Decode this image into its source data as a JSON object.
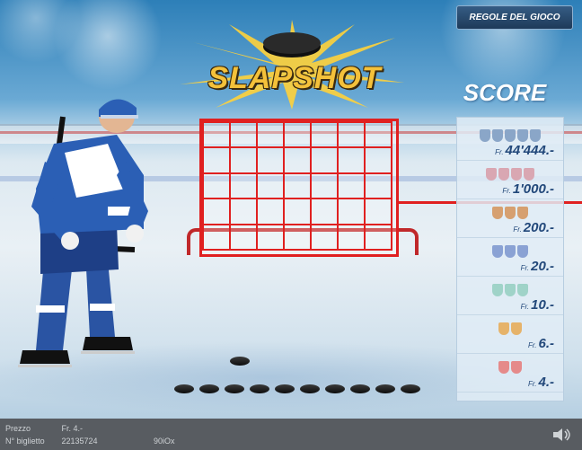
{
  "header": {
    "rules_label": "REGOLE DEL GIOCO"
  },
  "logo": {
    "text": "SLAPSHOT"
  },
  "score": {
    "title": "SCORE",
    "currency": "Fr.",
    "rows": [
      {
        "prize": "44'444.-",
        "icon_count": 5,
        "color": "#8aa6c8"
      },
      {
        "prize": "1'000.-",
        "icon_count": 4,
        "color": "#d9a7b2"
      },
      {
        "prize": "200.-",
        "icon_count": 3,
        "color": "#d6a070"
      },
      {
        "prize": "20.-",
        "icon_count": 3,
        "color": "#8aa2d4"
      },
      {
        "prize": "10.-",
        "icon_count": 3,
        "color": "#9fd3c8"
      },
      {
        "prize": "6.-",
        "icon_count": 2,
        "color": "#e6b36a"
      },
      {
        "prize": "4.-",
        "icon_count": 2,
        "color": "#e58a8a"
      }
    ]
  },
  "grid": {
    "rows": 5,
    "cols": 7
  },
  "pucks": {
    "count": 10
  },
  "footer": {
    "price_label": "Prezzo",
    "price_value": "Fr. 4.-",
    "ticket_label": "N° biglietto",
    "ticket_value": "22135724",
    "ticket_code": "90iOx"
  },
  "colors": {
    "accent": "#e02020",
    "bar": "#585c61"
  }
}
